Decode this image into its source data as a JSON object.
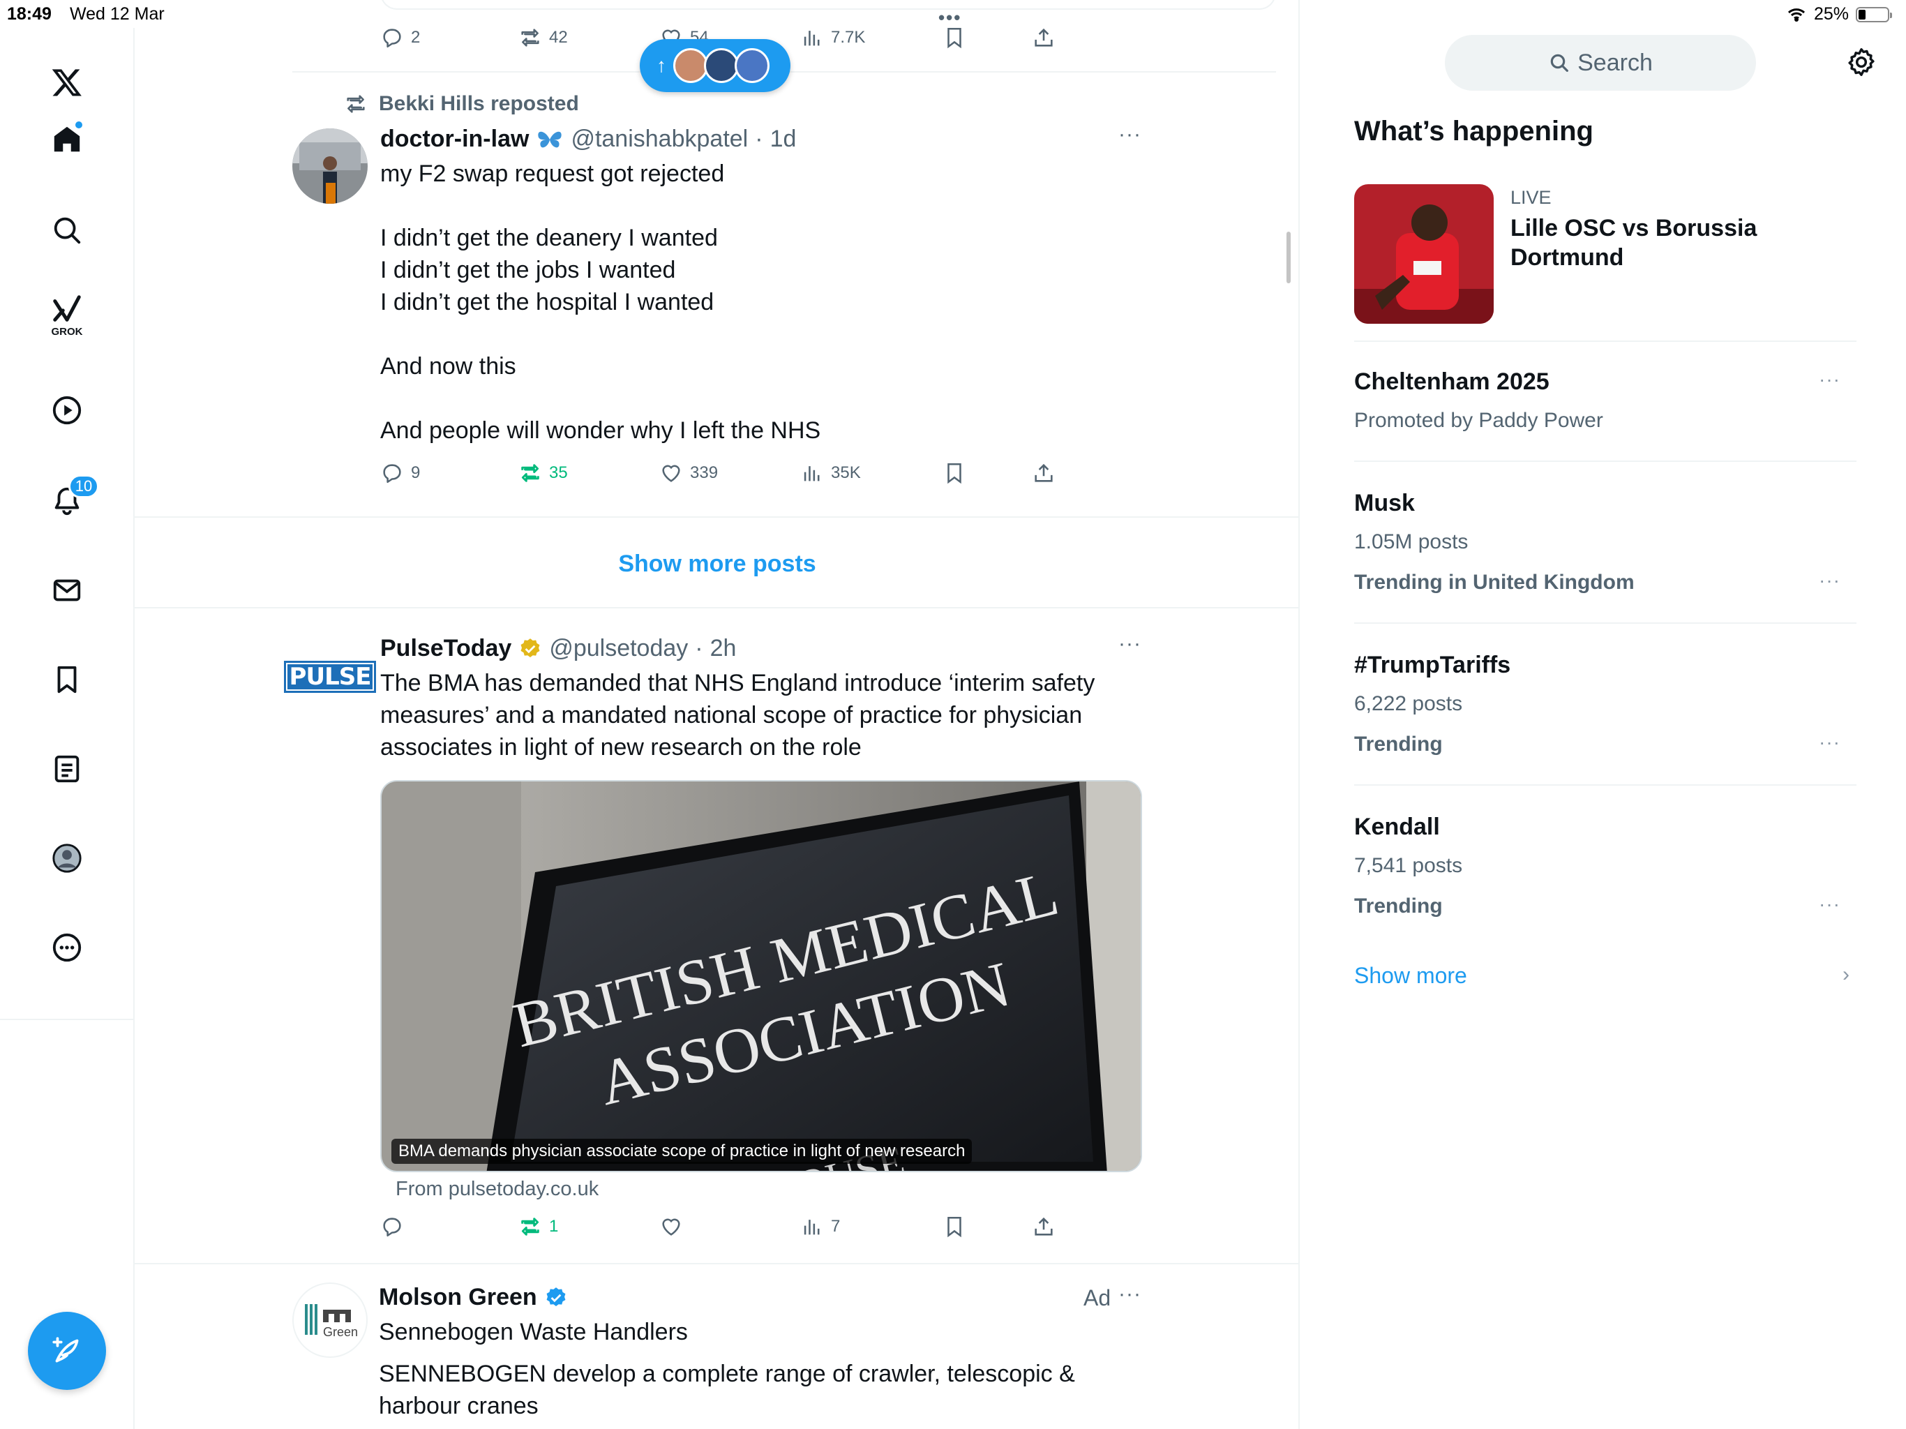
{
  "status_bar": {
    "time": "18:49",
    "date": "Wed 12 Mar",
    "battery": "25%",
    "battery_level": 0.25
  },
  "nav": {
    "items": [
      "x-logo",
      "home",
      "explore",
      "grok",
      "video",
      "notifications",
      "messages",
      "bookmarks",
      "lists",
      "profile",
      "more"
    ],
    "grok_label": "GROK",
    "notifications_count": "10"
  },
  "feed": {
    "top_post": {
      "replies": "2",
      "reposts": "42",
      "likes": "54",
      "views": "7.7K"
    },
    "repost": {
      "reposted_by": "Bekki Hills reposted",
      "name": "doctor-in-law",
      "handle": "@tanishabkpatel",
      "sep": "·",
      "time": "1d",
      "lines": [
        "my F2 swap request got rejected",
        "",
        "I didn’t get the deanery I wanted",
        "I didn’t get the jobs I wanted",
        "I didn’t get the hospital I wanted",
        "",
        "And now this",
        "",
        "And people will wonder why I left the NHS"
      ],
      "replies": "9",
      "reposts": "35",
      "likes": "339",
      "views": "35K"
    },
    "show_more_posts": "Show more posts",
    "pulse": {
      "logo_text": "PULSE",
      "name": "PulseToday",
      "handle": "@pulsetoday",
      "sep": "·",
      "time": "2h",
      "text": "The BMA has demanded that NHS England introduce ‘interim safety measures’ and a mandated national scope of practice for physician associates in light of new research on the role",
      "image_sign_line1": "BRITISH MEDICAL",
      "image_sign_line2": "ASSOCIATION",
      "image_sign_line3": "BMA HOUSE",
      "card_caption": "BMA demands physician associate scope of practice in light of new research",
      "source": "From pulsetoday.co.uk",
      "replies": "",
      "reposts": "1",
      "likes": "",
      "views": "7"
    },
    "ad": {
      "logo_text": "Green",
      "name": "Molson Green",
      "ad_label": "Ad",
      "subtitle": "Sennebogen Waste Handlers",
      "text": "SENNEBOGEN develop a complete range of crawler, telescopic & harbour cranes"
    }
  },
  "sidebar": {
    "search_placeholder": "Search",
    "title": "What’s happening",
    "live_label": "LIVE",
    "live_title": "Lille OSC vs Borussia Dortmund",
    "trends": [
      {
        "title": "Cheltenham 2025",
        "sub": "Promoted by Paddy Power",
        "meta": ""
      },
      {
        "title": "Musk",
        "sub": "1.05M posts",
        "meta": "Trending in United Kingdom"
      },
      {
        "title": "#TrumpTariffs",
        "sub": "6,222 posts",
        "meta": "Trending"
      },
      {
        "title": "Kendall",
        "sub": "7,541 posts",
        "meta": "Trending"
      }
    ],
    "show_more": "Show more"
  },
  "colors": {
    "accent": "#1d9bf0",
    "repost_green": "#00ba7c",
    "muted": "#536471",
    "divider": "#eff3f4"
  }
}
